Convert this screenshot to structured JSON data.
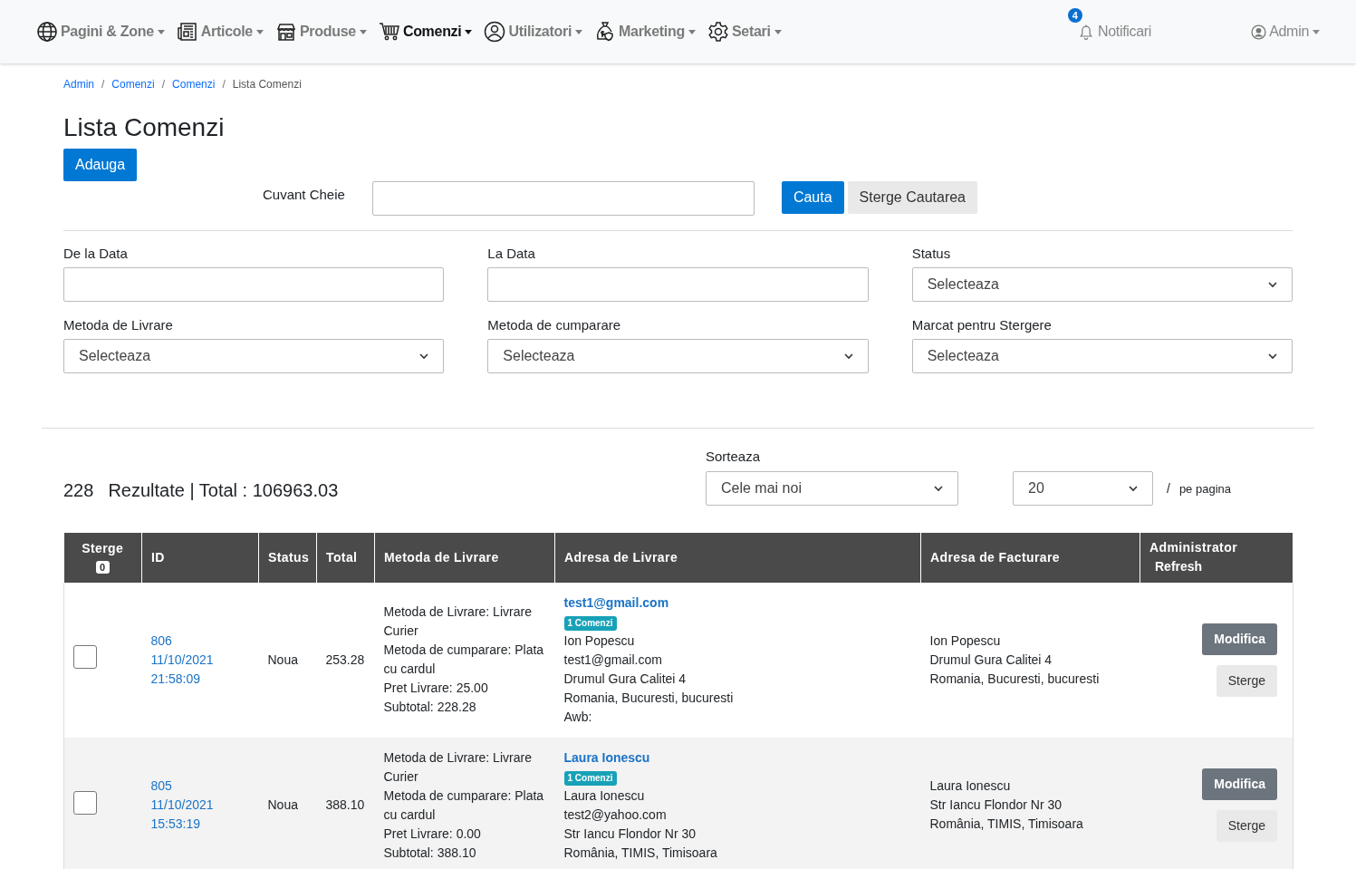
{
  "nav": {
    "items": [
      {
        "label": "Pagini & Zone",
        "selected": false
      },
      {
        "label": "Articole",
        "selected": false
      },
      {
        "label": "Produse",
        "selected": false
      },
      {
        "label": "Comenzi",
        "selected": true
      },
      {
        "label": "Utilizatori",
        "selected": false
      },
      {
        "label": "Marketing",
        "selected": false
      },
      {
        "label": "Setari",
        "selected": false
      }
    ],
    "notifications": {
      "label": "Notificari",
      "count": "4"
    },
    "user": {
      "label": "Admin"
    }
  },
  "breadcrumb": [
    {
      "label": "Admin",
      "current": false
    },
    {
      "separator": "/",
      "label": "Comenzi",
      "current": false
    },
    {
      "separator": "/",
      "label": "Comenzi",
      "current": false
    },
    {
      "separator": "/",
      "label": "Lista Comenzi",
      "current": true
    }
  ],
  "title": "Lista Comenzi",
  "add_button": "Adauga",
  "search": {
    "label": "Cuvant Cheie",
    "search_button": "Cauta",
    "clear_button": "Sterge Cautarea"
  },
  "filters": [
    {
      "label": "De la Data",
      "kind": "input"
    },
    {
      "label": "La Data",
      "kind": "input"
    },
    {
      "label": "Status",
      "kind": "select",
      "value": "Selecteaza"
    },
    {
      "label": "Metoda de Livrare",
      "kind": "select",
      "value": "Selecteaza"
    },
    {
      "label": "Metoda de cumparare",
      "kind": "select",
      "value": "Selecteaza"
    },
    {
      "label": "Marcat pentru Stergere",
      "kind": "select",
      "value": "Selecteaza"
    }
  ],
  "results": {
    "count": "228",
    "text": "Rezultate | Total : 106963.03"
  },
  "sort": {
    "label": "Sorteaza",
    "value": "Cele mai noi"
  },
  "per_page": {
    "value": "20",
    "separator": "/",
    "label": "pe pagina"
  },
  "table": {
    "columns": [
      {
        "label": "Sterge",
        "badge": "0"
      },
      {
        "label": "ID"
      },
      {
        "label": "Status"
      },
      {
        "label": "Total"
      },
      {
        "label": "Metoda de Livrare"
      },
      {
        "label": "Adresa de Livrare"
      },
      {
        "label": "Adresa de Facturare"
      },
      {
        "label": "Administrator",
        "sub": "Refresh"
      }
    ],
    "rows": [
      {
        "checked": false,
        "id": "806",
        "date": "11/10/2021",
        "time": "21:58:09",
        "status": "Noua",
        "total": "253.28",
        "delivery": [
          "Metoda de Livrare: Livrare Curier",
          "Metoda de cumparare: Plata cu cardul",
          "Pret Livrare: 25.00",
          "Subtotal: 228.28"
        ],
        "customer_link": "test1@gmail.com",
        "orders_badge": "1 Comenzi",
        "shipping": [
          "Ion Popescu",
          "test1@gmail.com",
          "Drumul Gura Calitei 4",
          "Romania, Bucuresti, bucuresti",
          "Awb:"
        ],
        "billing": [
          "Ion Popescu",
          "Drumul Gura Calitei 4",
          "Romania, Bucuresti, bucuresti"
        ],
        "edit_button": "Modifica",
        "delete_button": "Sterge"
      },
      {
        "checked": false,
        "id": "805",
        "date": "11/10/2021",
        "time": "15:53:19",
        "status": "Noua",
        "total": "388.10",
        "delivery": [
          "Metoda de Livrare: Livrare Curier",
          "Metoda de cumparare: Plata cu cardul",
          "Pret Livrare: 0.00",
          "Subtotal: 388.10"
        ],
        "customer_link": "Laura Ionescu",
        "orders_badge": "1 Comenzi",
        "shipping": [
          "Laura Ionescu",
          "test2@yahoo.com",
          "Str Iancu Flondor Nr 30",
          "România, TIMIS, Timisoara"
        ],
        "billing": [
          "Laura Ionescu",
          "Str Iancu Flondor Nr 30",
          "România, TIMIS, Timisoara"
        ],
        "edit_button": "Modifica",
        "delete_button": "Sterge"
      }
    ]
  }
}
